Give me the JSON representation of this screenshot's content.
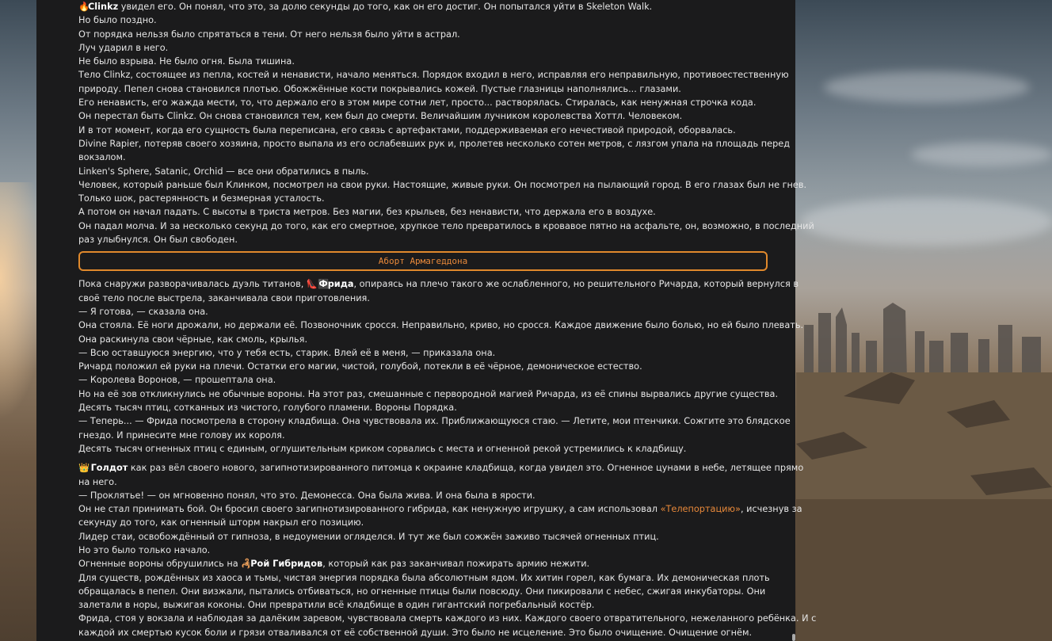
{
  "paragraphs_top": [
    {
      "name": "Clinkz",
      "name_icon": "🔥",
      "rest": " увидел его. Он понял, что это, за долю секунды до того, как он его достиг. Он попытался уйти в Skeleton Walk."
    },
    {
      "text": "Но было поздно."
    },
    {
      "text": "От порядка нельзя было спрятаться в тени. От него нельзя было уйти в астрал."
    },
    {
      "text": "Луч ударил в него."
    },
    {
      "text": "Не было взрыва. Не было огня. Была тишина."
    },
    {
      "text": "Тело Clinkz, состоящее из пепла, костей и ненависти, начало меняться. Порядок входил в него, исправляя его неправильную, противоестественную"
    },
    {
      "text": "природу. Пепел снова становился плотью. Обожжённые кости покрывались кожей. Пустые глазницы наполнялись... глазами."
    },
    {
      "text": "Его ненависть, его жажда мести, то, что держало его в этом мире сотни лет, просто... растворялась. Стиралась, как ненужная строчка кода."
    },
    {
      "text": "Он перестал быть Clinkz. Он снова становился тем, кем был до смерти. Величайшим лучником королевства Хоттл. Человеком."
    },
    {
      "text": "И в тот момент, когда его сущность была переписана, его связь с артефактами, поддерживаемая его нечестивой природой, оборвалась."
    },
    {
      "text": "Divine Rapier, потеряв своего хозяина, просто выпала из его ослабевших рук и, пролетев несколько сотен метров, с лязгом упала на площадь перед"
    },
    {
      "text": "вокзалом."
    },
    {
      "text": "Linken's Sphere, Satanic, Orchid — все они обратились в пыль."
    },
    {
      "text": "Человек, который раньше был Клинком, посмотрел на свои руки. Настоящие, живые руки. Он посмотрел на пылающий город. В его глазах был не гнев."
    },
    {
      "text": "Только шок, растерянность и безмерная усталость."
    },
    {
      "text": "А потом он начал падать. С высоты в триста метров. Без магии, без крыльев, без ненависти, что держала его в воздухе."
    },
    {
      "text": "Он падал молча. И за несколько секунд до того, как его смертное, хрупкое тело превратилось в кровавое пятно на асфальте, он, возможно, в последний"
    },
    {
      "text": "раз улыбнулся. Он был свободен."
    }
  ],
  "section_title": "Аборт Армагеддона",
  "frida": {
    "prefix": "Пока снаружи разворачивалась дуэль титанов, ",
    "icons": "👠⬛",
    "name": "Фрида",
    "rest": ", опираясь на плечо такого же ослабленного, но решительного Ричарда, который вернулся в",
    "lines": [
      "своё тело после выстрела, заканчивала свои приготовления.",
      "— Я готова, — сказала она.",
      "Она стояла. Её ноги дрожали, но держали её. Позвоночник сросся. Неправильно, криво, но сросся. Каждое движение было болью, но ей было плевать.",
      "Она раскинула свои чёрные, как смоль, крылья.",
      "— Всю оставшуюся энергию, что у тебя есть, старик. Влей её в меня, — приказала она.",
      "Ричард положил ей руки на плечи. Остатки его магии, чистой, голубой, потекли в её чёрное, демоническое естество.",
      "— Королева Воронов, — прошептала она.",
      "Но на её зов откликнулись не обычные вороны. На этот раз, смешанные с первородной магией Ричарда, из её спины вырвались другие существа.",
      "Десять тысяч птиц, сотканных из чистого, голубого пламени. Вороны Порядка.",
      "— Теперь... — Фрида посмотрела в сторону кладбища. Она чувствовала их. Приближающуюся стаю. — Летите, мои птенчики. Сожгите это блядское",
      "гнездо. И принесите мне голову их короля.",
      "Десять тысяч огненных птиц с единым, оглушительным криком сорвались с места и огненной рекой устремились к кладбищу."
    ]
  },
  "goldot": {
    "icon": "👑",
    "name": "Голдот",
    "rest": " как раз вёл своего нового, загипнотизированного питомца к окраине кладбища, когда увидел это. Огненное цунами в небе, летящее прямо",
    "line2": "на него.",
    "line3": "— Проклятье! — он мгновенно понял, что это. Демонесса. Она была жива. И она была в ярости.",
    "line4_pre": "Он не стал принимать бой. Он бросил своего загипнотизированного гибрида, как ненужную игрушку, а сам использовал ",
    "line4_link": "«Телепортацию»",
    "line4_post": ", исчезнув за",
    "lines_after": [
      "секунду до того, как огненный шторм накрыл его позицию.",
      "Лидер стаи, освобождённый от гипноза, в недоумении огляделся. И тут же был сожжён заживо тысячей огненных птиц.",
      "Но это было только начало."
    ],
    "swarm_pre": "Огненные вороны обрушились на ",
    "swarm_icon": "🦂",
    "swarm_name": "Рой Гибридов",
    "swarm_post": ", который как раз заканчивал пожирать армию нежити.",
    "tail_lines": [
      "Для существ, рождённых из хаоса и тьмы, чистая энергия порядка была абсолютным ядом. Их хитин горел, как бумага. Их демоническая плоть",
      "обращалась в пепел. Они визжали, пытались отбиваться, но огненные птицы были повсюду. Они пикировали с небес, сжигая инкубаторы. Они",
      "залетали в норы, выжигая коконы. Они превратили всё кладбище в один гигантский погребальный костёр.",
      "Фрида, стоя у вокзала и наблюдая за далёким заревом, чувствовала смерть каждого из них. Каждого своего отвратительного, нежеланного ребёнка. И с",
      "каждой их смертью кусок боли и грязи отваливался от её собственной души. Это было не исцеление. Это было очищение. Очищение огнём."
    ]
  },
  "colors": {
    "accent": "#e0892c",
    "panel": "#1b1b1c",
    "text": "#e6e6e6"
  }
}
